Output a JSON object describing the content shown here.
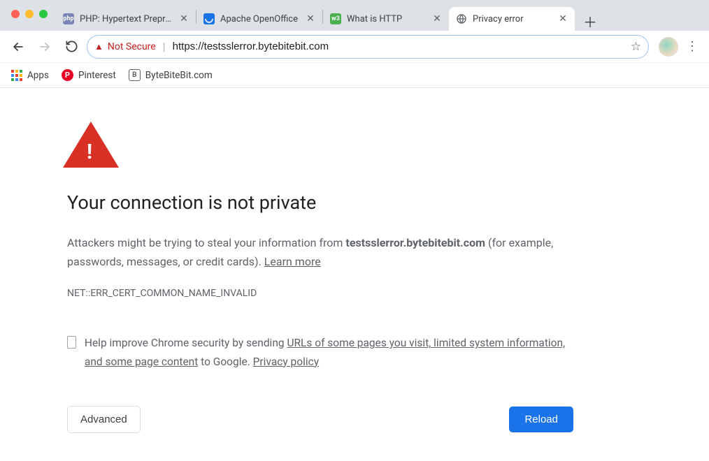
{
  "tabs": [
    {
      "title": "PHP: Hypertext Preprocessor"
    },
    {
      "title": "Apache OpenOffice"
    },
    {
      "title": "What is HTTP"
    },
    {
      "title": "Privacy error"
    }
  ],
  "omnibox": {
    "security_label": "Not Secure",
    "url": "https://testsslerror.bytebitebit.com"
  },
  "bookmarks": {
    "apps": "Apps",
    "pinterest": "Pinterest",
    "bbb": "ByteBiteBit.com"
  },
  "page": {
    "title": "Your connection is not private",
    "desc_before": "Attackers might be trying to steal your information from ",
    "desc_domain": "testsslerror.bytebitebit.com",
    "desc_after": " (for example, passwords, messages, or credit cards). ",
    "learn_more": "Learn more",
    "error_code": "NET::ERR_CERT_COMMON_NAME_INVALID",
    "checkbox_prefix": "Help improve Chrome security by sending ",
    "checkbox_link1": "URLs of some pages you visit, limited system information, and some page content",
    "checkbox_mid": " to Google. ",
    "checkbox_link2": "Privacy policy",
    "advanced": "Advanced",
    "reload": "Reload"
  }
}
